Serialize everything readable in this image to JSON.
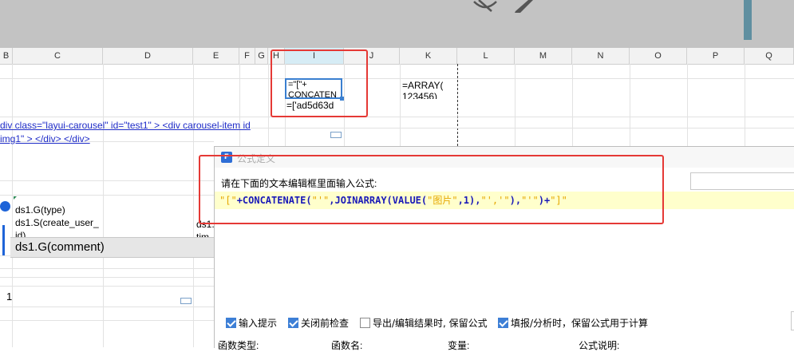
{
  "toolbar": {
    "hide_icon": "eye-slash-icon",
    "edit_icon": "pencil-icon"
  },
  "columns": {
    "b": "B",
    "c": "C",
    "d": "D",
    "e": "E",
    "f": "F",
    "g": "G",
    "h": "H",
    "i": "I",
    "j": "J",
    "k": "K",
    "l": "L",
    "m": "M",
    "n": "N",
    "o": "O",
    "p": "P",
    "q": "Q"
  },
  "cells": {
    "i_formula_line1": "=\"[\"+",
    "i_formula_line2": "CONCATEN",
    "i_result": "=['ad5d63d",
    "k_formula": "=ARRAY(",
    "k_formula_line2": "123456)",
    "html_line1": "div class=\"layui-carousel\" id=\"test1\"  >    <div carousel-item  id",
    "html_line2": "img1\" >       </div> </div>",
    "ds_type": "ds1.G(type)",
    "ds_create_user": "ds1.S(create_user_",
    "ds_create_user_cont": "id)",
    "ds_e_partial": "ds1.",
    "ds_e_partial2": "tim",
    "ds_comment": "ds1.G(comment)",
    "row_number": "1"
  },
  "dialog": {
    "title": "公式定义",
    "prompt": "请在下面的文本编辑框里面输入公式:",
    "formula_parts": {
      "p1": "\"[\"",
      "p2": "+CONCATENATE(",
      "p3": "\"'\"",
      "p4": ",JOINARRAY(VALUE(",
      "p5": "\"图片\"",
      "p6": ",1),",
      "p7": "\"','\"",
      "p8": "),",
      "p9": "\"'\"",
      "p10": ")+",
      "p11": "\"]\""
    },
    "checkboxes": [
      {
        "label": "输入提示",
        "checked": true
      },
      {
        "label": "关闭前检查",
        "checked": true
      },
      {
        "label": "导出/编辑结果时, 保留公式",
        "checked": false
      },
      {
        "label": "填报/分析时，保留公式用于计算",
        "checked": true
      }
    ],
    "panes": {
      "func_type": "函数类型:",
      "func_name": "函数名:",
      "variable": "变量:",
      "description": "公式说明:"
    }
  },
  "colors": {
    "string": "#e6a700",
    "keyword": "#1a1ab8",
    "annotation": "#e53935",
    "accent": "#3d7fd6"
  }
}
